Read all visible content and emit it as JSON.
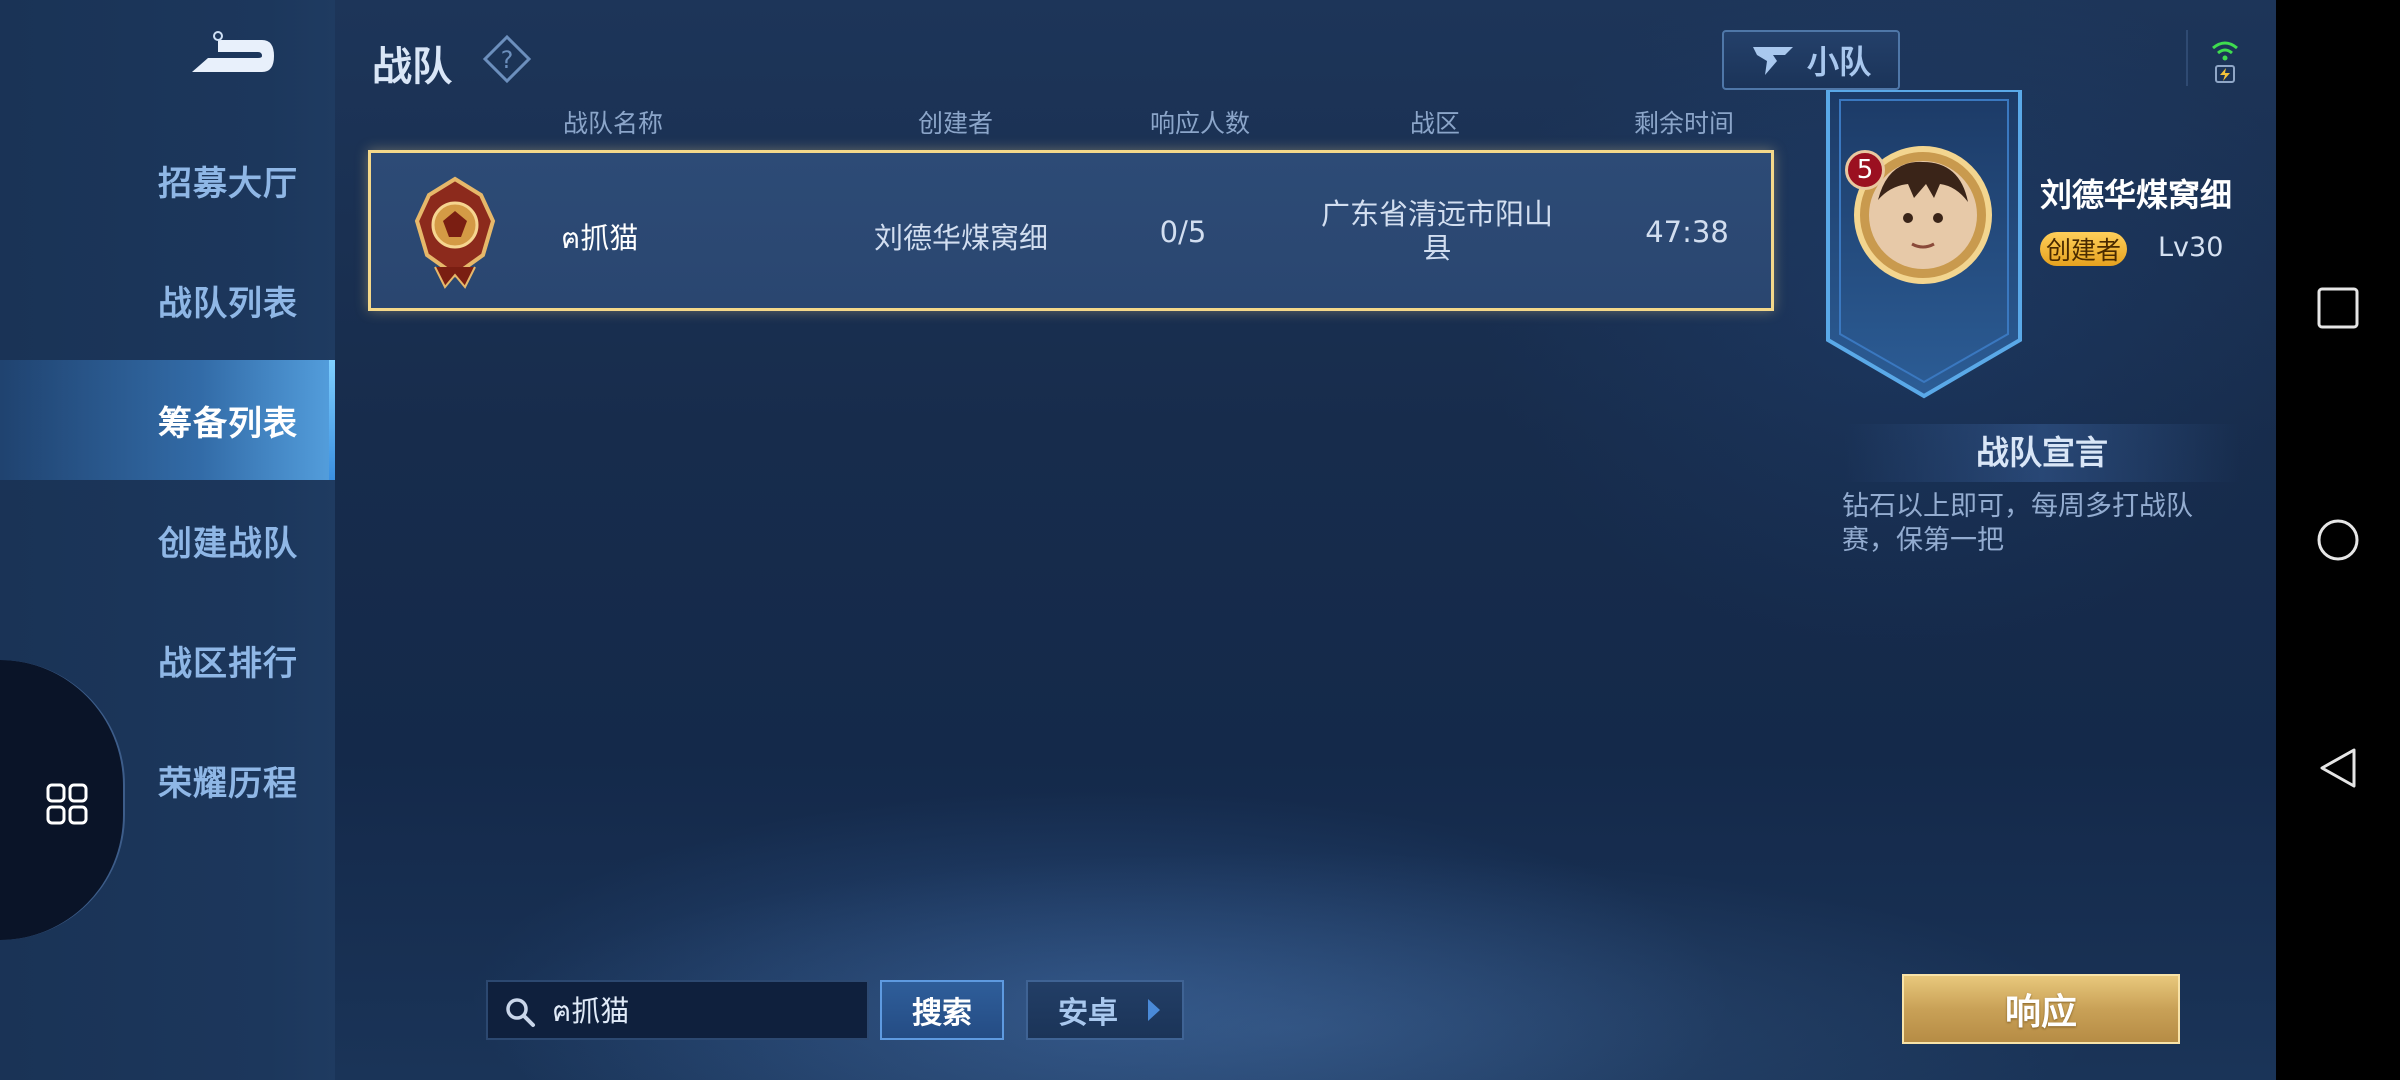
{
  "header": {
    "title": "战队",
    "squad_label": "小队"
  },
  "sidebar": {
    "items": [
      {
        "label": "招募大厅",
        "active": false
      },
      {
        "label": "战队列表",
        "active": false
      },
      {
        "label": "筹备列表",
        "active": true
      },
      {
        "label": "创建战队",
        "active": false
      },
      {
        "label": "战区排行",
        "active": false
      },
      {
        "label": "荣耀历程",
        "active": false
      }
    ]
  },
  "table": {
    "headers": [
      "战队名称",
      "创建者",
      "响应人数",
      "战区",
      "剩余时间"
    ],
    "rows": [
      {
        "name": "ฅ抓猫",
        "creator": "刘德华煤窝细",
        "responses": "0/5",
        "region": "广东省清远市阳山县",
        "time_left": "47:38"
      }
    ]
  },
  "detail": {
    "creator_name": "刘德华煤窝细",
    "creator_tag": "创建者",
    "level": "Lv30",
    "avatar_badge": "5",
    "manifesto_title": "战队宣言",
    "manifesto_text": "钻石以上即可，每周多打战队赛，保第一把"
  },
  "bottom": {
    "search_value": "ฅ抓猫",
    "search_button": "搜索",
    "platform": "安卓",
    "respond_button": "响应"
  },
  "colors": {
    "accent_gold": "#f4d88a",
    "active_blue": "#5aa9e8"
  }
}
